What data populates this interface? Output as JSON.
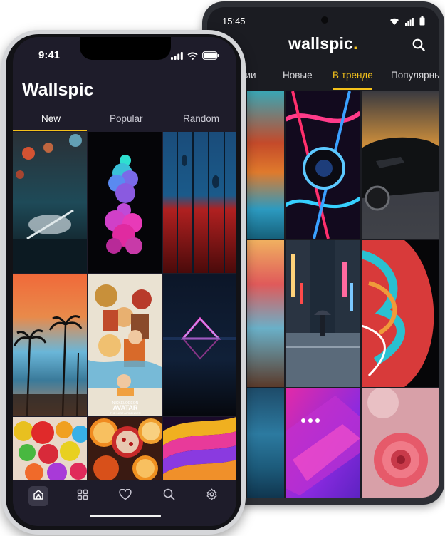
{
  "android": {
    "status_time": "15:45",
    "logo_text": "wallspic",
    "logo_dot": ".",
    "tabs": [
      {
        "label": "рии",
        "active": false
      },
      {
        "label": "Новые",
        "active": false
      },
      {
        "label": "В тренде",
        "active": true
      },
      {
        "label": "Популярны",
        "active": false
      }
    ],
    "icons": {
      "search": "search-icon",
      "wifi": "wifi-icon",
      "signal": "signal-icon",
      "battery": "battery-icon"
    }
  },
  "iphone": {
    "status_time": "9:41",
    "app_title": "Wallspic",
    "tabs": [
      {
        "label": "New",
        "active": true
      },
      {
        "label": "Popular",
        "active": false
      },
      {
        "label": "Random",
        "active": false
      }
    ],
    "bottom_nav": [
      "home-icon",
      "grid-icon",
      "heart-icon",
      "search-icon",
      "settings-icon"
    ],
    "active_nav": "home-icon",
    "icons": {
      "signal": "signal-icon",
      "wifi": "wifi-icon",
      "battery": "battery-icon"
    }
  },
  "wallpapers": {
    "avatar_logo_top": "NICKELODEON",
    "avatar_logo_main": "AVATAR",
    "avatar_logo_sub": "THE LAST AIRBENDER"
  },
  "colors": {
    "accent": "#f5c21b",
    "background": "#1e1c2a",
    "android_background": "#1b1c22"
  }
}
